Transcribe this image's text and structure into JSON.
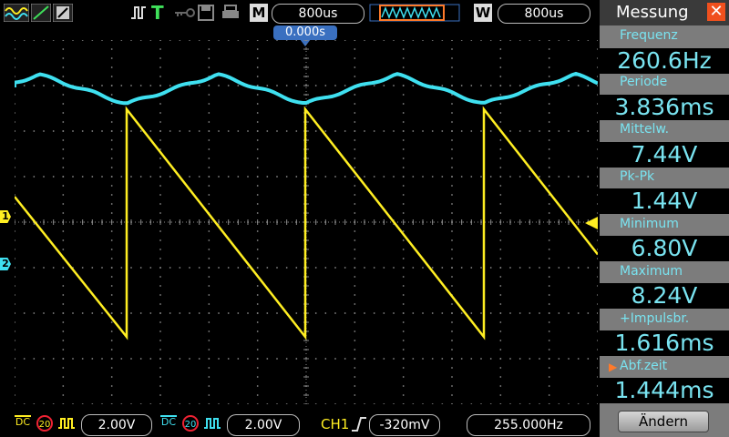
{
  "topbar": {
    "mode_M": "M",
    "timebase": "800us",
    "mode_W": "W",
    "window_timebase": "800us",
    "trigger_T": "T"
  },
  "screen": {
    "trigger_position": "0.000s",
    "ch1_marker": "1",
    "ch2_marker": "2"
  },
  "panel": {
    "title": "Messung",
    "close_glyph": "✕",
    "measurements": [
      {
        "label": "Frequenz",
        "value": "260.6Hz"
      },
      {
        "label": "Periode",
        "value": "3.836ms"
      },
      {
        "label": "Mittelw.",
        "value": "7.44V"
      },
      {
        "label": "Pk-Pk",
        "value": "1.44V"
      },
      {
        "label": "Minimum",
        "value": "6.80V"
      },
      {
        "label": "Maximum",
        "value": "8.24V"
      },
      {
        "label": "+Impulsbr.",
        "value": "1.616ms"
      },
      {
        "label": "Abf.zeit",
        "value": "1.444ms"
      }
    ],
    "change_button": "Ändern"
  },
  "bottombar": {
    "ch1_coupling": "DC",
    "ch1_bw": "20",
    "ch1_scale": "2.00V",
    "ch2_coupling": "DC",
    "ch2_bw": "20",
    "ch2_scale": "2.00V",
    "trigger_source": "CH1",
    "trigger_level": "-320mV",
    "trigger_freq": "255.000Hz"
  },
  "colors": {
    "ch1": "#ffee22",
    "ch2": "#3fe0f0",
    "grid": "#8a8a8a",
    "panel_bg": "#7c7c7c",
    "accent": "#f0501e"
  }
}
